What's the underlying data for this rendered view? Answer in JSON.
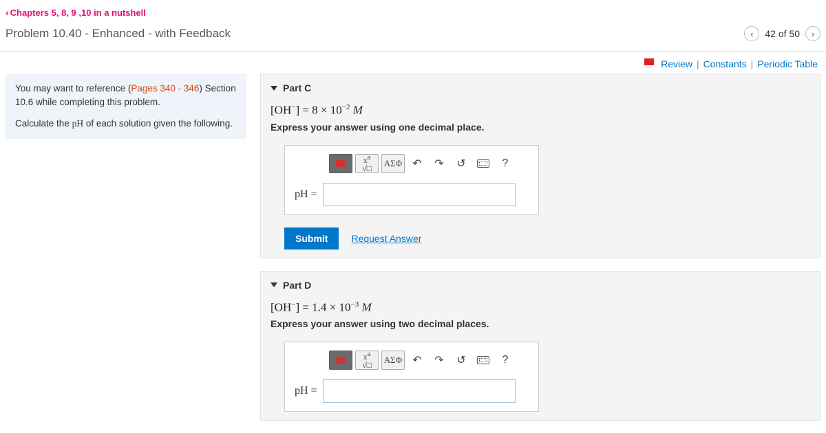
{
  "header": {
    "back_link": "Chapters 5, 8, 9 ,10 in a nutshell",
    "problem_title": "Problem 10.40 - Enhanced - with Feedback",
    "nav_count": "42 of 50"
  },
  "top_links": {
    "review": "Review",
    "constants": "Constants",
    "periodic": "Periodic Table"
  },
  "reference": {
    "line1a": "You may want to reference (",
    "pages": "Pages 340 - 346",
    "line1b": ") Section 10.6 while completing this problem.",
    "line2a": "Calculate the ",
    "ph": "pH",
    "line2b": " of each solution given the following."
  },
  "parts": {
    "c": {
      "label": "Part C",
      "formula_prefix": "[OH",
      "formula_sup1": "−",
      "formula_mid": "] = 8 × 10",
      "formula_sup2": "−2",
      "formula_suffix": " M",
      "instruction": "Express your answer using one decimal place.",
      "greek": "ΑΣΦ",
      "input_label": "pH = ",
      "submit": "Submit",
      "request": "Request Answer"
    },
    "d": {
      "label": "Part D",
      "formula_prefix": "[OH",
      "formula_sup1": "−",
      "formula_mid": "] = 1.4 × 10",
      "formula_sup2": "−3",
      "formula_suffix": " M",
      "instruction": "Express your answer using two decimal places.",
      "greek": "ΑΣΦ",
      "input_label": "pH = "
    }
  }
}
